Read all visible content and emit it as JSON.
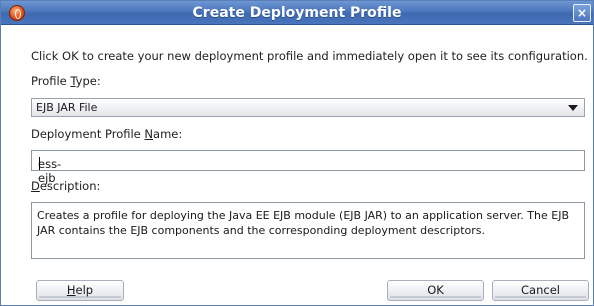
{
  "window": {
    "title": "Create Deployment Profile",
    "close_label": "×",
    "app_icon": "oracle-jdeveloper-icon"
  },
  "instruction": "Click OK to create your new deployment profile and immediately open it to see its configuration.",
  "profile_type": {
    "label_pre": "Profile ",
    "label_mnemonic": "T",
    "label_post": "ype:",
    "selected": "EJB JAR File"
  },
  "profile_name": {
    "label_pre": "Deployment Profile ",
    "label_mnemonic": "N",
    "label_post": "ame:",
    "value": "ess-ejb"
  },
  "description": {
    "label_mnemonic": "D",
    "label_post": "escription:",
    "text": "Creates a profile for deploying the Java EE EJB module (EJB JAR) to an application server. The EJB JAR contains the EJB components and the corresponding deployment descriptors."
  },
  "buttons": {
    "help_mnemonic": "H",
    "help_post": "elp",
    "ok": "OK",
    "cancel": "Cancel"
  }
}
